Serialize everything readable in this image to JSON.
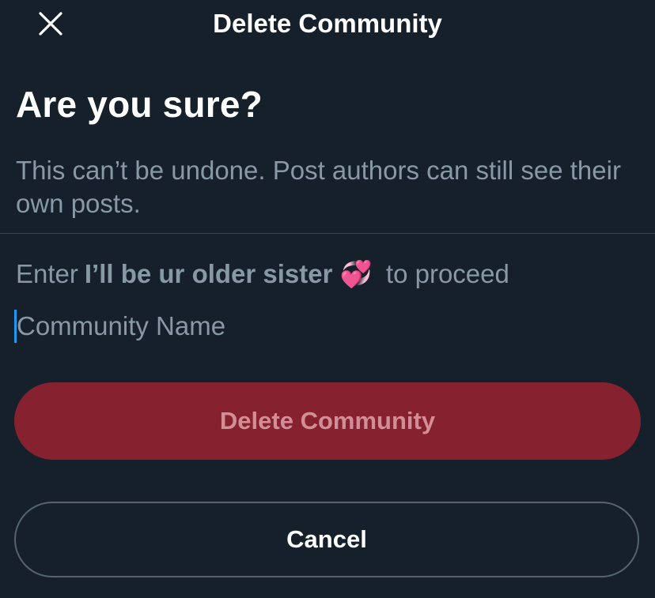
{
  "header": {
    "title": "Delete Community",
    "close_icon": "close-icon"
  },
  "dialog": {
    "heading": "Are you sure?",
    "description": "This can’t be undone. Post authors can still see their own posts."
  },
  "confirm": {
    "prefix": "Enter",
    "community_name": "I’ll be ur older sister",
    "emoji": "💞",
    "suffix": "to proceed",
    "input_placeholder": "Community Name",
    "input_value": ""
  },
  "buttons": {
    "delete_label": "Delete Community",
    "cancel_label": "Cancel"
  },
  "colors": {
    "background": "#15202b",
    "muted_text": "#8899a6",
    "delete_button": "#86212f",
    "delete_text_disabled": "#d28e97",
    "cancel_border": "#536471",
    "caret": "#1d9bf0"
  }
}
